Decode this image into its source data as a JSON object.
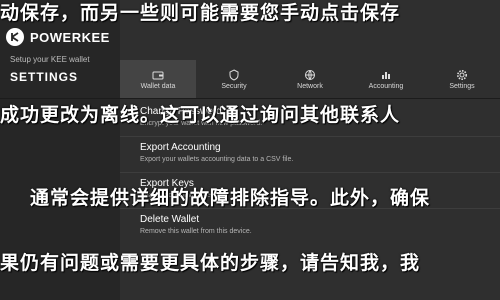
{
  "app": {
    "brand": "POWERKEE",
    "subtitle": "Setup your KEE wallet",
    "page_title": "SETTINGS"
  },
  "tabs": [
    {
      "label": "Wallet data",
      "icon": "wallet-icon",
      "active": true
    },
    {
      "label": "Security",
      "icon": "shield-icon",
      "active": false
    },
    {
      "label": "Network",
      "icon": "network-icon",
      "active": false
    },
    {
      "label": "Accounting",
      "icon": "chart-icon",
      "active": false
    },
    {
      "label": "Settings",
      "icon": "gear-icon",
      "active": false
    }
  ],
  "sections": [
    {
      "title": "Change Password",
      "desc": "Encrypt your wallet with new password."
    },
    {
      "title": "Export Accounting",
      "desc": "Export your wallets accounting data to a CSV file."
    },
    {
      "title": "Export Keys",
      "desc": "Display your private keys."
    },
    {
      "title": "Delete Wallet",
      "desc": "Remove this wallet from this device."
    }
  ],
  "overlay": {
    "line1": "动保存，而另一些则可能需要您手动点击保存",
    "line2": "成功更改为离线。这可以通过询问其他联系人",
    "line3": "通常会提供详细的故障排除指导。此外，确保",
    "line4": "果仍有问题或需要更具体的步骤，请告知我，我"
  },
  "colors": {
    "panel_bg": "#2f2f2f",
    "sidebar_bg": "#262626",
    "active_tab": "#444444",
    "overlay_text": "#ffffff"
  }
}
